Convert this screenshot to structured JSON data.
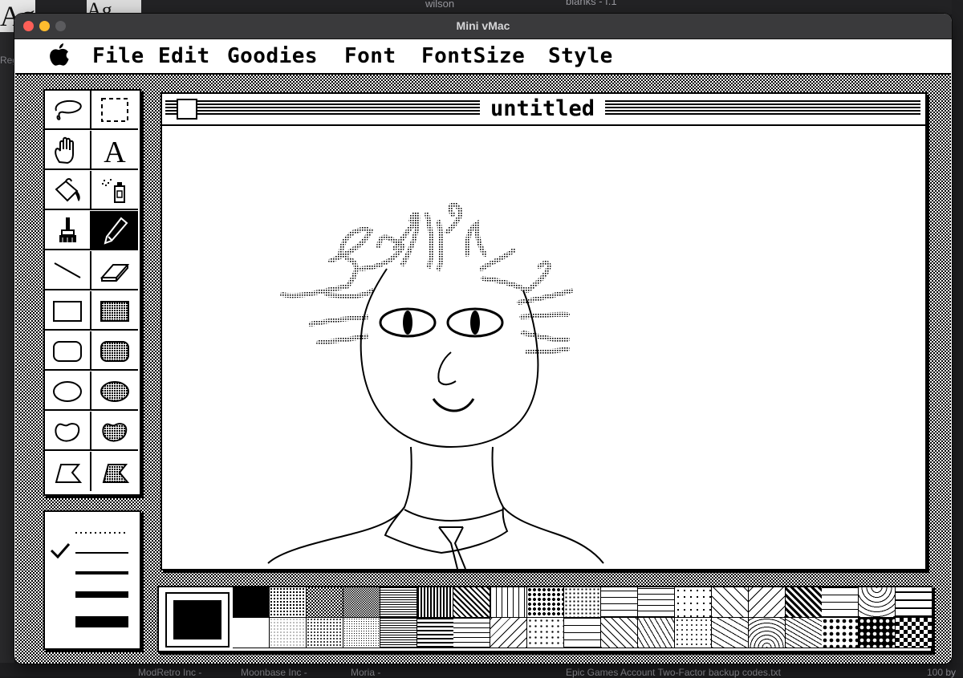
{
  "background": {
    "finder_items": [
      "wilson",
      "blanks - f.1"
    ],
    "bottom_items": [
      "ModRetro Inc -",
      "Moonbase Inc -",
      "Moria -",
      "Epic Games Account Two-Factor backup codes.txt",
      "100 by"
    ],
    "left_label": "Reg",
    "ag_text": "Ag"
  },
  "window": {
    "title": "Mini vMac"
  },
  "menubar": {
    "apple_icon": "apple-logo",
    "items": [
      "File",
      "Edit",
      "Goodies",
      "Font",
      "FontSize",
      "Style"
    ]
  },
  "document": {
    "title": "untitled"
  },
  "tools": {
    "items": [
      {
        "name": "lasso",
        "icon": "lasso-icon"
      },
      {
        "name": "selection-rectangle",
        "icon": "marquee-icon"
      },
      {
        "name": "grabber",
        "icon": "hand-icon"
      },
      {
        "name": "text",
        "icon": "text-a-icon",
        "glyph": "A"
      },
      {
        "name": "paint-bucket",
        "icon": "paint-bucket-icon"
      },
      {
        "name": "spray-can",
        "icon": "spray-can-icon"
      },
      {
        "name": "paintbrush",
        "icon": "paintbrush-icon"
      },
      {
        "name": "pencil",
        "icon": "pencil-icon",
        "selected": true
      },
      {
        "name": "line",
        "icon": "line-icon"
      },
      {
        "name": "eraser",
        "icon": "eraser-icon"
      },
      {
        "name": "rectangle",
        "icon": "rectangle-icon"
      },
      {
        "name": "filled-rectangle",
        "icon": "filled-rectangle-icon"
      },
      {
        "name": "rounded-rectangle",
        "icon": "rounded-rectangle-icon"
      },
      {
        "name": "filled-rounded-rectangle",
        "icon": "filled-rounded-rectangle-icon"
      },
      {
        "name": "oval",
        "icon": "oval-icon"
      },
      {
        "name": "filled-oval",
        "icon": "filled-oval-icon"
      },
      {
        "name": "freeform",
        "icon": "freeform-icon"
      },
      {
        "name": "filled-freeform",
        "icon": "filled-freeform-icon"
      },
      {
        "name": "polygon",
        "icon": "polygon-icon"
      },
      {
        "name": "filled-polygon",
        "icon": "filled-polygon-icon"
      }
    ]
  },
  "line_widths": {
    "options": [
      "dotted",
      "1",
      "2",
      "4",
      "8"
    ],
    "selected_index": 1
  },
  "patterns": {
    "current": "solid-black",
    "count": 38
  },
  "colors": {
    "titlebar": "#3a3a3c",
    "close": "#fe5f57",
    "minimize": "#febc2e",
    "ink": "#000000",
    "paper": "#ffffff"
  }
}
